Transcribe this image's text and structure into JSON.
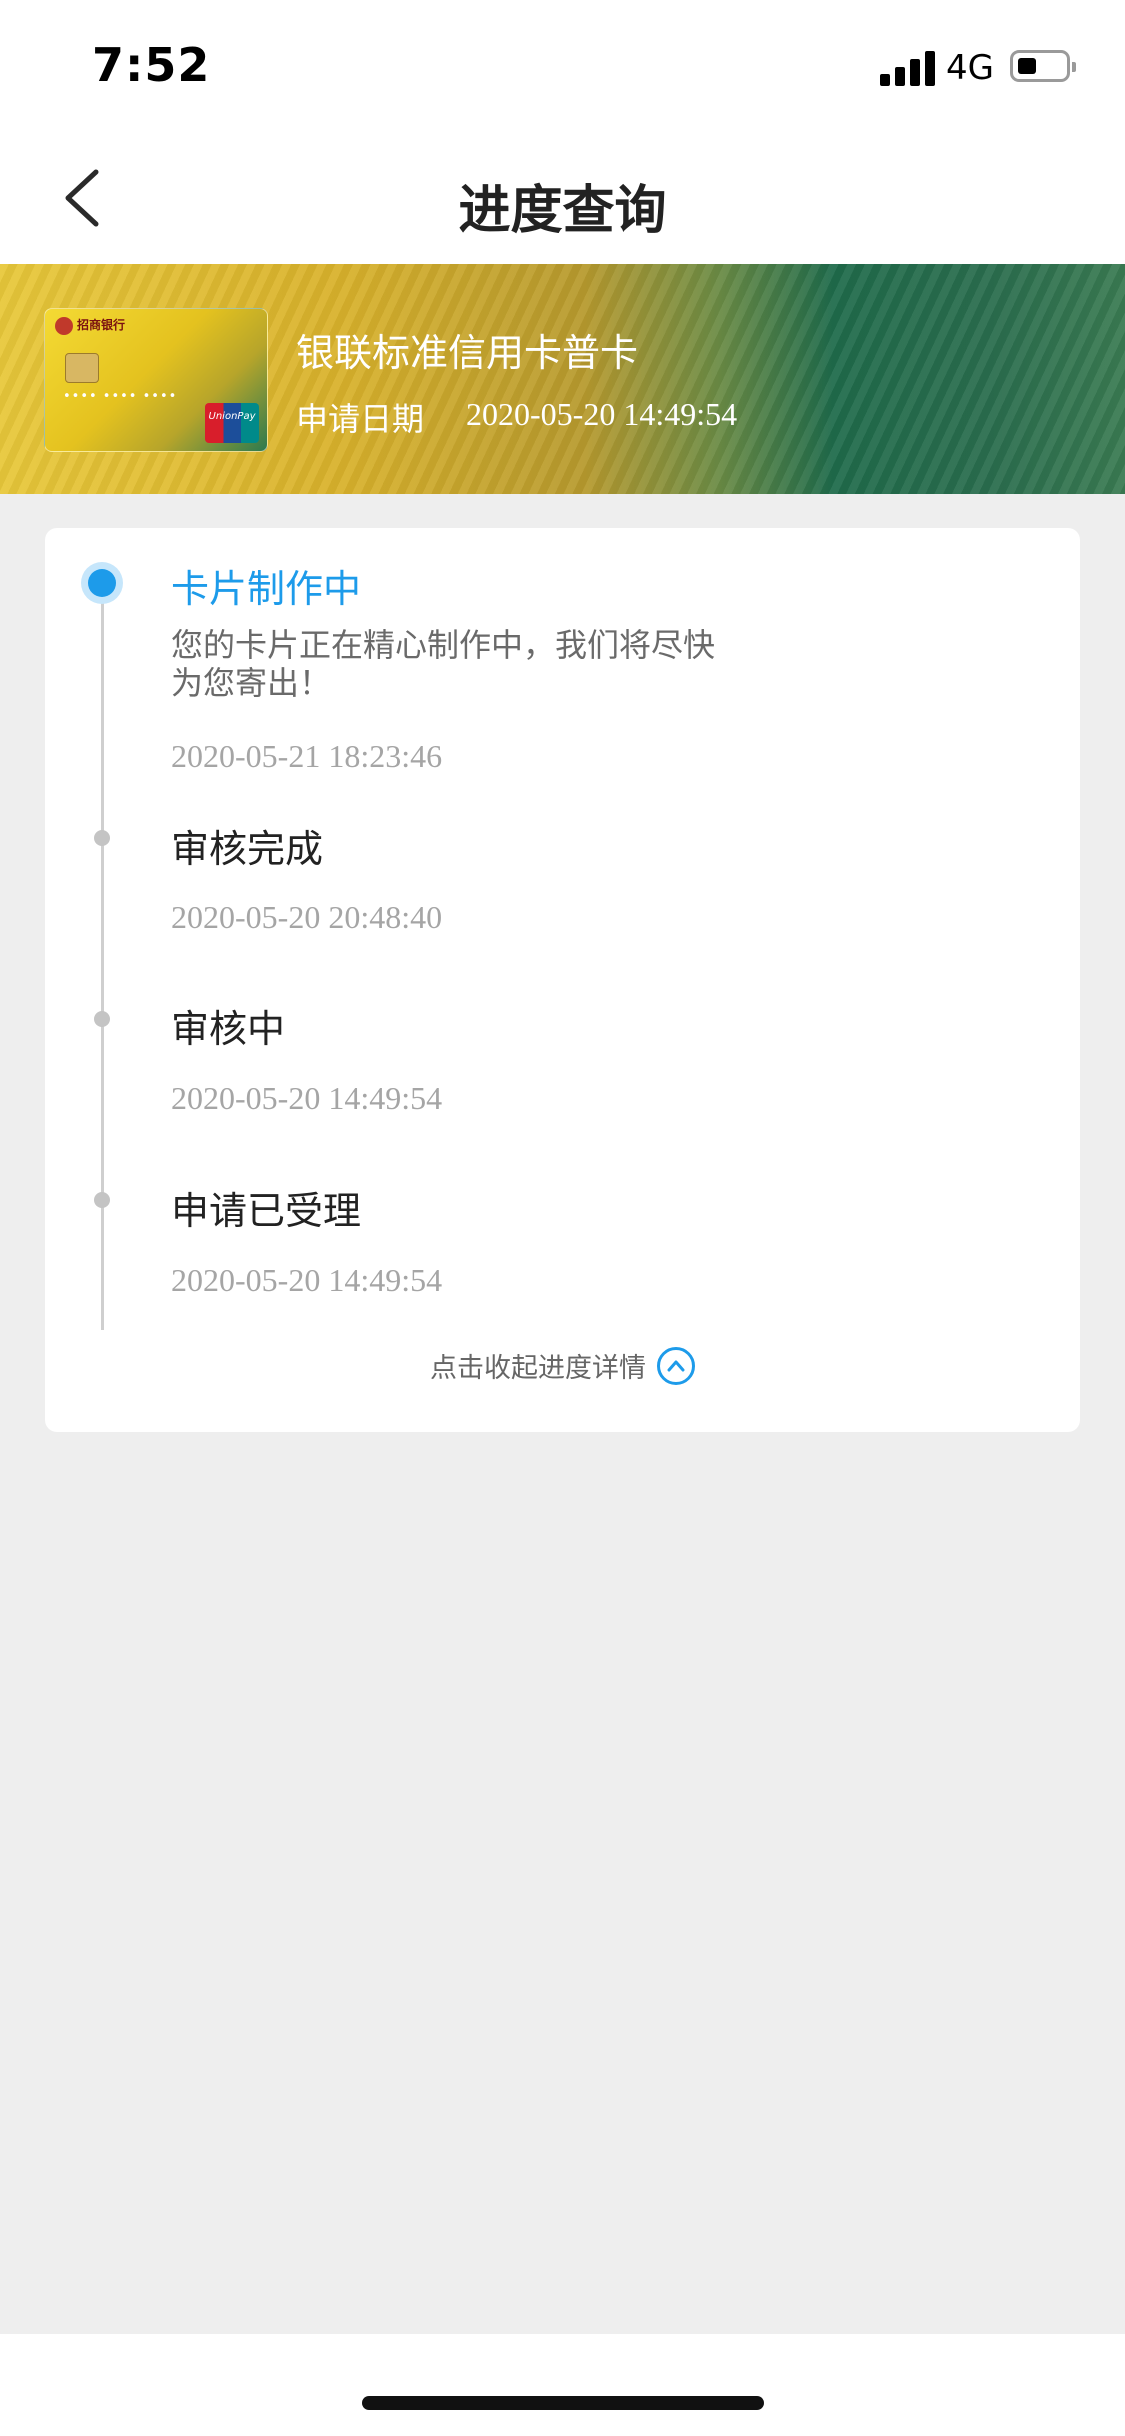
{
  "status_bar": {
    "time": "7:52",
    "network": "4G",
    "battery_level": 0.3
  },
  "nav": {
    "title": "进度查询",
    "back_icon": "chevron-left-icon"
  },
  "card": {
    "bank": "招商银行",
    "name": "银联标准信用卡普卡",
    "apply_label": "申请日期",
    "apply_date": "2020-05-20 14:49:54"
  },
  "progress": {
    "steps": [
      {
        "title": "卡片制作中",
        "desc": "您的卡片正在精心制作中，我们将尽快为您寄出！",
        "time": "2020-05-21 18:23:46",
        "active": true
      },
      {
        "title": "审核完成",
        "time": "2020-05-20 20:48:40",
        "active": false
      },
      {
        "title": "审核中",
        "time": "2020-05-20 14:49:54",
        "active": false
      },
      {
        "title": "申请已受理",
        "time": "2020-05-20 14:49:54",
        "active": false
      }
    ],
    "collapse_label": "点击收起进度详情",
    "collapse_icon": "chevron-up-circle-icon"
  },
  "colors": {
    "accent": "#1d9bea",
    "background": "#eeeeee"
  }
}
